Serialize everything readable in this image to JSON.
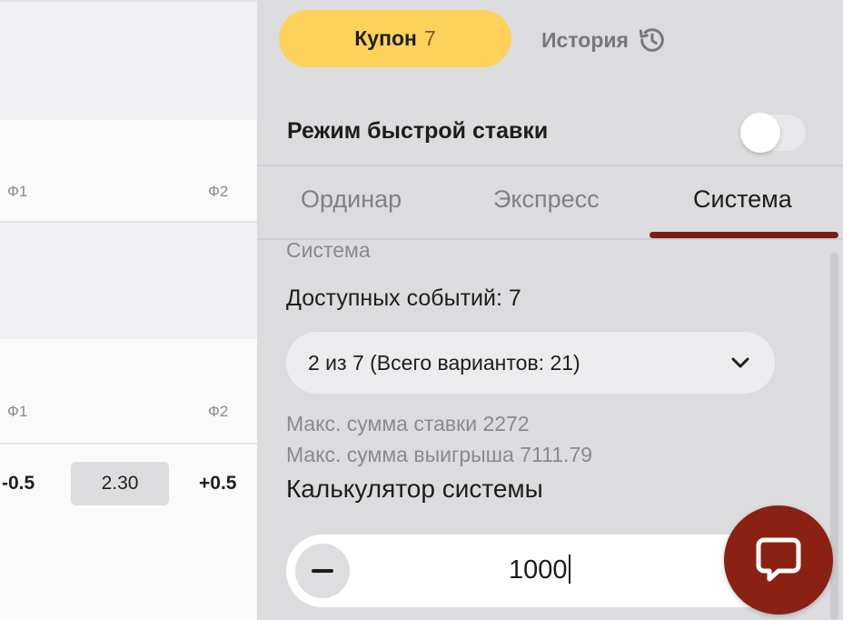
{
  "left": {
    "market1": {
      "f1_label": "Ф1",
      "f2_label": "Ф2"
    },
    "market2": {
      "f1_label": "Ф1",
      "f2_label": "Ф2",
      "handicap_left": "-0.5",
      "odds": "2.30",
      "handicap_right": "+0.5"
    }
  },
  "coupon": {
    "tab_coupon_label": "Купон",
    "tab_coupon_count": "7",
    "tab_history_label": "История",
    "fast_bet_label": "Режим быстрой ставки",
    "fast_bet_enabled": false,
    "bet_tabs": [
      "Ординар",
      "Экспресс",
      "Система"
    ],
    "active_bet_tab": "Система",
    "system_title": "Система",
    "available_events": "Доступных событий: 7",
    "system_select_value": "2 из 7 (Всего вариантов: 21)",
    "max_stake": "Макс. сумма ставки 2272",
    "max_win": "Макс. сумма выигрыша 7111.79",
    "calculator_title": "Калькулятор системы",
    "stake_amount": "1000"
  },
  "colors": {
    "accent_yellow": "#fdd25a",
    "active_underline": "#7a1f15",
    "chat_button": "#8b2113"
  },
  "icons": {
    "history": "history-icon",
    "chevron": "chevron-down-icon",
    "minus": "minus-icon",
    "chat": "chat-icon"
  }
}
